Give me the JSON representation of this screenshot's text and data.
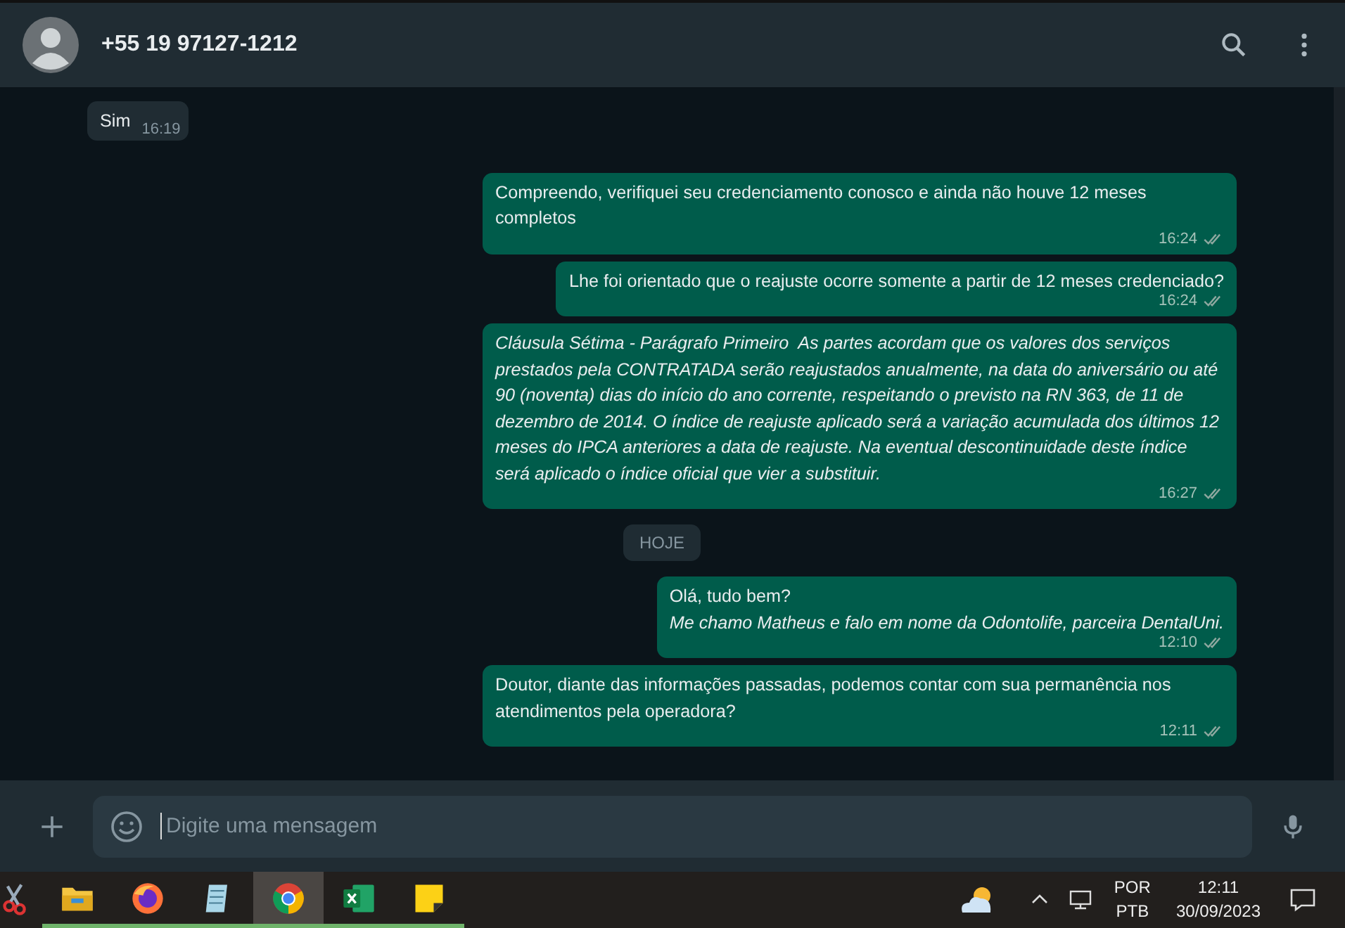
{
  "header": {
    "contact": "+55 19 97127-1212"
  },
  "messages": [
    {
      "kind": "incoming",
      "text": "Sim",
      "time": "16:19",
      "italic": false
    },
    {
      "kind": "outgoing",
      "text": "Compreendo, verifiquei seu credenciamento conosco e ainda não houve 12 meses completos",
      "time": "16:24",
      "italic": false
    },
    {
      "kind": "outgoing",
      "text": "Lhe foi orientado que o reajuste ocorre somente a partir de 12 meses credenciado?",
      "time": "16:24",
      "italic": false
    },
    {
      "kind": "outgoing",
      "text": "Cláusula Sétima - Parágrafo Primeiro  As partes acordam que os valores dos serviços prestados pela CONTRATADA serão reajustados anualmente, na data do aniversário ou até 90 (noventa) dias do início do ano corrente, respeitando o previsto na RN 363, de 11 de dezembro de 2014. O índice de reajuste aplicado será a variação acumulada dos últimos 12 meses do IPCA anteriores a data de reajuste. Na eventual descontinuidade deste índice será aplicado o índice oficial que vier a substituir.",
      "time": "16:27",
      "italic": true
    },
    {
      "kind": "date",
      "text": "HOJE"
    },
    {
      "kind": "outgoing",
      "text": "Olá, tudo bem?\n*Me chamo Matheus e falo em nome da Odontolife, parceira DentalUni.*",
      "time": "12:10",
      "italic": false
    },
    {
      "kind": "outgoing",
      "text": "Doutor, diante das informações passadas, podemos contar com sua permanência nos atendimentos pela operadora?",
      "time": "12:11",
      "italic": false
    }
  ],
  "composer": {
    "placeholder": "Digite uma mensagem"
  },
  "taskbar": {
    "apps": [
      {
        "kind": "snip",
        "selected": false
      },
      {
        "kind": "folder",
        "selected": false
      },
      {
        "kind": "firefox",
        "selected": false
      },
      {
        "kind": "notepad",
        "selected": false
      },
      {
        "kind": "chrome",
        "selected": true
      },
      {
        "kind": "excel",
        "selected": false
      },
      {
        "kind": "sticky",
        "selected": false
      }
    ],
    "language": "POR",
    "layout": "PTB",
    "time": "12:11",
    "date": "30/09/2023"
  }
}
